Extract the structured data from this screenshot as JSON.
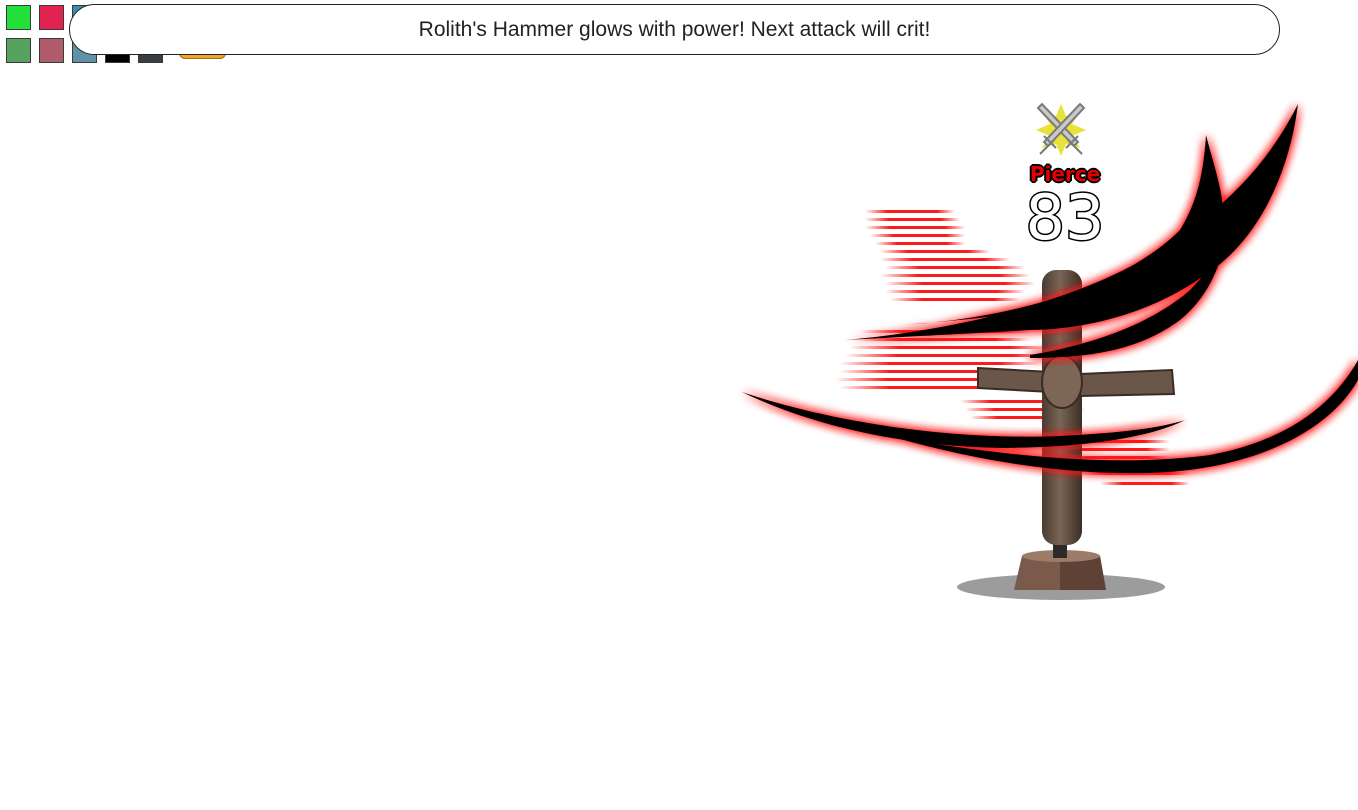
{
  "hotbar": {
    "swatches": [
      {
        "color": "#22e03a"
      },
      {
        "color": "#e0234f"
      },
      {
        "color": "#3b8fae"
      },
      {
        "color": "#55a35f"
      },
      {
        "color": "#b05c6c"
      },
      {
        "color": "#5e92a6"
      },
      {
        "color": "#000000"
      },
      {
        "color": "#3a3d42"
      }
    ],
    "accent_color": "#f3a32b"
  },
  "combat_message": "Rolith's Hammer glows with power! Next attack will crit!",
  "target": {
    "type": "training-dummy",
    "status_icon": "crossed-swords-icon"
  },
  "damage_popup": {
    "type": "Pierce",
    "value": "83",
    "type_color": "#e40000"
  },
  "effects": {
    "slash_color": "#000000",
    "glow_color": "#ff1a1a"
  }
}
